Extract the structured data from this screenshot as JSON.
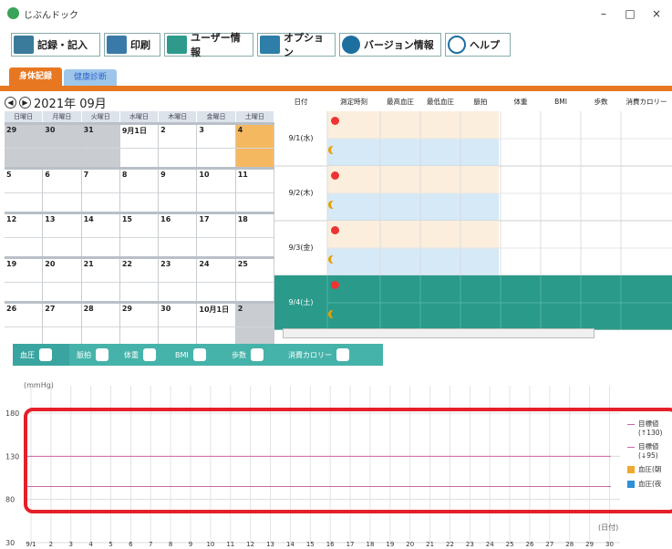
{
  "window": {
    "title": "じぶんドック",
    "minimize": "–",
    "maximize": "□",
    "close": "×"
  },
  "toolbar": [
    {
      "label": "記録・記入",
      "icon": "record-icon"
    },
    {
      "label": "印刷",
      "icon": "printer-icon"
    },
    {
      "label": "ユーザー情報",
      "icon": "user-icon"
    },
    {
      "label": "オプション",
      "icon": "options-grid-icon"
    },
    {
      "label": "バージョン情報",
      "icon": "info-icon"
    },
    {
      "label": "ヘルプ",
      "icon": "help-icon"
    }
  ],
  "top_tabs": [
    "身体記録",
    "健康診断"
  ],
  "calendar": {
    "title": "2021年 09月",
    "weekdays": [
      "日曜日",
      "月曜日",
      "火曜日",
      "水曜日",
      "木曜日",
      "金曜日",
      "土曜日"
    ],
    "weeks": [
      [
        "29",
        "30",
        "31",
        "9月1日",
        "2",
        "3",
        "4"
      ],
      [
        "5",
        "6",
        "7",
        "8",
        "9",
        "10",
        "11"
      ],
      [
        "12",
        "13",
        "14",
        "15",
        "16",
        "17",
        "18"
      ],
      [
        "19",
        "20",
        "21",
        "22",
        "23",
        "24",
        "25"
      ],
      [
        "26",
        "27",
        "28",
        "29",
        "30",
        "10月1日",
        "2"
      ]
    ]
  },
  "table": {
    "headers": [
      "日付",
      "測定時刻",
      "最高血圧",
      "最低血圧",
      "脈拍",
      "体重",
      "BMI",
      "歩数",
      "消費カロリー"
    ],
    "rows": [
      {
        "date": "9/1(水)"
      },
      {
        "date": "9/2(木)"
      },
      {
        "date": "9/3(金)"
      },
      {
        "date": "9/4(土)"
      }
    ]
  },
  "bottom_tabs": [
    {
      "label": "血圧",
      "icon": "blood-pressure-icon"
    },
    {
      "label": "脈拍",
      "icon": "heart-icon"
    },
    {
      "label": "体重",
      "icon": "scale-icon"
    },
    {
      "label": "BMI",
      "icon": "bmi-person-icon"
    },
    {
      "label": "歩数",
      "icon": "footprint-icon"
    },
    {
      "label": "消費カロリー",
      "icon": "flame-icon"
    }
  ],
  "colors": {
    "accent_orange": "#e87722",
    "teal": "#2a9a8a",
    "morning_bg": "#fbeedd",
    "evening_bg": "#d5e9f7",
    "target_line": "#cc66aa",
    "highlight_rect": "#e4202a"
  },
  "chart_data": {
    "type": "line",
    "ylabel": "(mmHg)",
    "xlabel": "(日付)",
    "ylim": [
      30,
      180
    ],
    "yticks": [
      30,
      80,
      130,
      180
    ],
    "x": [
      "9/1",
      "2",
      "3",
      "4",
      "5",
      "6",
      "7",
      "8",
      "9",
      "10",
      "11",
      "12",
      "13",
      "14",
      "15",
      "16",
      "17",
      "18",
      "19",
      "20",
      "21",
      "22",
      "23",
      "24",
      "25",
      "26",
      "27",
      "28",
      "29",
      "30"
    ],
    "target_lines": [
      130,
      95
    ],
    "grid": true,
    "legend": [
      {
        "label": "目標値 (↑130)",
        "color": "#cc66aa",
        "kind": "line"
      },
      {
        "label": "目標値 (↓95)",
        "color": "#cc66aa",
        "kind": "line"
      },
      {
        "label": "血圧(朝",
        "color": "#f0a830",
        "kind": "box"
      },
      {
        "label": "血圧(夜",
        "color": "#2f8fd8",
        "kind": "box"
      }
    ]
  }
}
